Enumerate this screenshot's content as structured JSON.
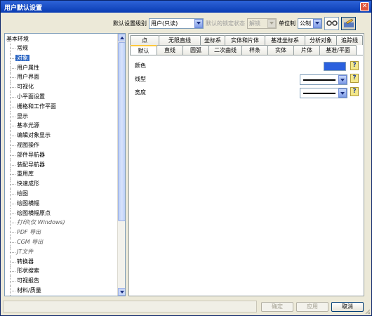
{
  "window": {
    "title": "用户默认设置",
    "close_icon": "close-icon"
  },
  "toolbar": {
    "level_label": "默认设置级别",
    "level_value": "用户(只读)",
    "lock_label": "默认的锁定状态",
    "lock_value": "解锁",
    "unit_label": "单位制",
    "unit_value": "公制",
    "view_icon": "eyeglasses-icon",
    "edit_icon": "edit-icon"
  },
  "tree": {
    "root": "基本环境",
    "items": [
      {
        "label": "常规"
      },
      {
        "label": "对象",
        "selected": true
      },
      {
        "label": "用户属性"
      },
      {
        "label": "用户界面"
      },
      {
        "label": "可视化"
      },
      {
        "label": "小平面设置"
      },
      {
        "label": "栅格和工作平面"
      },
      {
        "label": "显示"
      },
      {
        "label": "基本光源"
      },
      {
        "label": "编辑对象显示"
      },
      {
        "label": "视图操作"
      },
      {
        "label": "部件导航器"
      },
      {
        "label": "装配导航器"
      },
      {
        "label": "重用库"
      },
      {
        "label": "快速成形"
      },
      {
        "label": "绘图"
      },
      {
        "label": "绘图横幅"
      },
      {
        "label": "绘图横幅原点"
      },
      {
        "label": "打印(仅 Windows)",
        "italic": true
      },
      {
        "label": "PDF 导出",
        "italic": true
      },
      {
        "label": "CGM 导出",
        "italic": true
      },
      {
        "label": "JT文件",
        "italic": true
      },
      {
        "label": "转换器"
      },
      {
        "label": "形状搜索"
      },
      {
        "label": "可视报告"
      },
      {
        "label": "材料/质量"
      }
    ]
  },
  "tabs": {
    "row1": [
      "点",
      "无限直线",
      "坐标系",
      "实体和片体",
      "基准坐标系",
      "分析对象",
      "追踪线"
    ],
    "row2": [
      "默认",
      "直线",
      "圆弧",
      "二次曲线",
      "样条",
      "实体",
      "片体",
      "基准/平面"
    ],
    "active": "默认"
  },
  "properties": {
    "color_label": "颜色",
    "color_value": "#2b60de",
    "linetype_label": "线型",
    "width_label": "宽度",
    "help_text": "?"
  },
  "buttons": {
    "ok": "确定",
    "apply": "应用",
    "cancel": "取消"
  }
}
